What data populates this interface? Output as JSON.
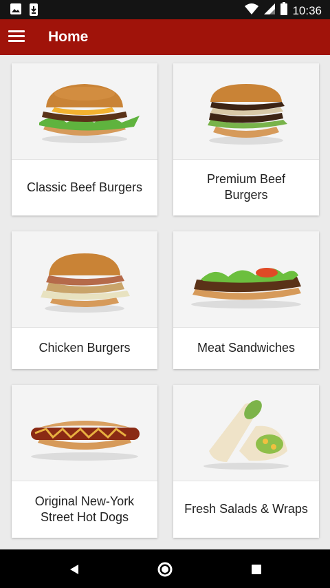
{
  "status_bar": {
    "time": "10:36",
    "left_icons": [
      "image-icon",
      "download-icon"
    ],
    "right_icons": [
      "wifi-icon",
      "signal-icon",
      "battery-icon"
    ]
  },
  "app_bar": {
    "title": "Home",
    "menu_icon": "hamburger-menu-icon"
  },
  "categories": [
    {
      "label": "Classic Beef Burgers",
      "image": "classic-beef-burger-image"
    },
    {
      "label": "Premium Beef Burgers",
      "image": "premium-beef-burger-image"
    },
    {
      "label": "Chicken Burgers",
      "image": "chicken-burger-image"
    },
    {
      "label": "Meat Sandwiches",
      "image": "meat-sandwich-image"
    },
    {
      "label": "Original New-York Street Hot Dogs",
      "image": "hot-dog-image"
    },
    {
      "label": "Fresh Salads & Wraps",
      "image": "wrap-image"
    }
  ],
  "nav_bar": {
    "buttons": [
      "back-icon",
      "home-icon",
      "recent-apps-icon"
    ]
  },
  "colors": {
    "app_bar": "#a0130a",
    "status_bar": "#141414",
    "background": "#ebebeb",
    "card": "#ffffff"
  }
}
